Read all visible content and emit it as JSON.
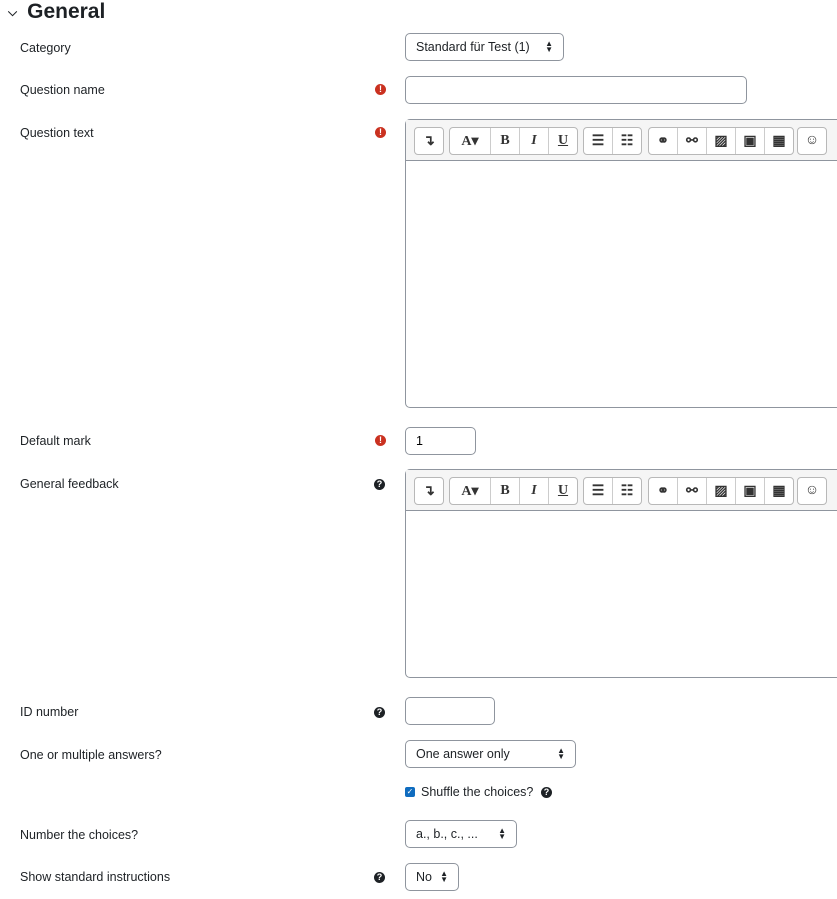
{
  "section": {
    "title": "General"
  },
  "fields": {
    "category": {
      "label": "Category",
      "value": "Standard für Test (1)"
    },
    "question_name": {
      "label": "Question name",
      "value": ""
    },
    "question_text": {
      "label": "Question text"
    },
    "default_mark": {
      "label": "Default mark",
      "value": "1"
    },
    "general_feedback": {
      "label": "General feedback"
    },
    "id_number": {
      "label": "ID number",
      "value": ""
    },
    "single": {
      "label": "One or multiple answers?",
      "value": "One answer only"
    },
    "shuffle": {
      "label": "Shuffle the choices?",
      "checked": true
    },
    "numbering": {
      "label": "Number the choices?",
      "value": "a., b., c., ..."
    },
    "instructions": {
      "label": "Show standard instructions",
      "value": "No"
    }
  },
  "toolbar": {
    "collapse": "↴",
    "font": "A▾",
    "bold": "B",
    "italic": "I",
    "underline": "U",
    "ul": "☰",
    "ol": "☷",
    "link": "⚭",
    "unlink": "⚯",
    "image": "▨",
    "media": "▣",
    "table": "▦",
    "emoji": "☺"
  },
  "icons": {
    "required": "!",
    "help": "?",
    "check": "✓",
    "chevron": "⌄"
  },
  "colors": {
    "required": "#ca3120",
    "checkbox": "#0f6cbf"
  }
}
